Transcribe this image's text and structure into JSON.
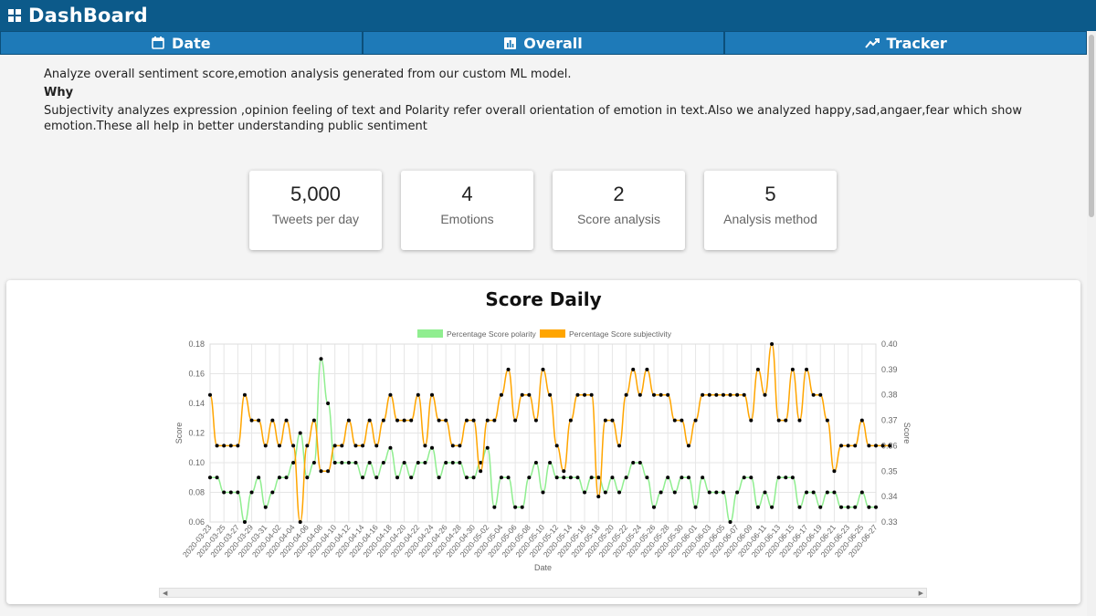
{
  "header": {
    "title": "DashBoard",
    "logo_icon": "dashboard-grid-icon"
  },
  "tabs": [
    {
      "label": "Date",
      "icon": "calendar-icon"
    },
    {
      "label": "Overall",
      "icon": "bar-chart-icon"
    },
    {
      "label": "Tracker",
      "icon": "trend-line-icon"
    }
  ],
  "intro": {
    "text": "Analyze overall sentiment score,emotion analysis generated from our custom ML model.",
    "why_heading": "Why",
    "why_text": "Subjectivity analyzes expression ,opinion feeling of text and Polarity refer overall orientation of emotion in text.Also we analyzed happy,sad,angaer,fear which show emotion.These all help in better understanding public sentiment"
  },
  "cards": [
    {
      "value": "5,000",
      "label": "Tweets per day"
    },
    {
      "value": "4",
      "label": "Emotions"
    },
    {
      "value": "2",
      "label": "Score analysis"
    },
    {
      "value": "5",
      "label": "Analysis method"
    }
  ],
  "colors": {
    "header": "#0c5a8a",
    "tab": "#1e7ab8",
    "polarity": "#90ee90",
    "subjectivity": "#ffa500"
  },
  "chart_data": {
    "type": "line",
    "title": "Score Daily",
    "xlabel": "Date",
    "ylabel_left": "Score",
    "ylabel_right": "Score",
    "x_start": "2020-03-23",
    "x_end": "2020-06-28",
    "tick_labels": [
      "2020-03-23",
      "2020-03-25",
      "2020-03-27",
      "2020-03-29",
      "2020-03-31",
      "2020-04-02",
      "2020-04-04",
      "2020-04-06",
      "2020-04-08",
      "2020-04-10",
      "2020-04-12",
      "2020-04-14",
      "2020-04-16",
      "2020-04-18",
      "2020-04-20",
      "2020-04-22",
      "2020-04-24",
      "2020-04-26",
      "2020-04-28",
      "2020-04-30",
      "2020-05-02",
      "2020-05-04",
      "2020-05-06",
      "2020-05-08",
      "2020-05-10",
      "2020-05-12",
      "2020-05-14",
      "2020-05-16",
      "2020-05-18",
      "2020-05-20",
      "2020-05-22",
      "2020-05-24",
      "2020-05-26",
      "2020-05-28",
      "2020-05-30",
      "2020-06-01",
      "2020-06-03",
      "2020-06-05",
      "2020-06-07",
      "2020-06-09",
      "2020-06-11",
      "2020-06-13",
      "2020-06-15",
      "2020-06-17",
      "2020-06-19",
      "2020-06-21",
      "2020-06-23",
      "2020-06-25",
      "2020-06-27"
    ],
    "y_left_range": [
      0.06,
      0.18
    ],
    "y_left_ticks": [
      "0.06",
      "0.08",
      "0.10",
      "0.12",
      "0.14",
      "0.16",
      "0.18"
    ],
    "y_right_range": [
      0.33,
      0.4
    ],
    "y_right_ticks": [
      "0.33",
      "0.34",
      "0.35",
      "0.36",
      "0.37",
      "0.38",
      "0.39",
      "0.40"
    ],
    "legend_position": "top",
    "series": [
      {
        "name": "Percentage Score polarity",
        "axis": "left",
        "color": "#90ee90",
        "values": [
          0.09,
          0.09,
          0.08,
          0.08,
          0.08,
          0.06,
          0.08,
          0.09,
          0.07,
          0.08,
          0.09,
          0.09,
          0.1,
          0.12,
          0.09,
          0.1,
          0.17,
          0.14,
          0.1,
          0.1,
          0.1,
          0.1,
          0.09,
          0.1,
          0.09,
          0.1,
          0.11,
          0.09,
          0.1,
          0.09,
          0.1,
          0.1,
          0.11,
          0.09,
          0.1,
          0.1,
          0.1,
          0.09,
          0.09,
          0.1,
          0.11,
          0.07,
          0.09,
          0.09,
          0.07,
          0.07,
          0.09,
          0.1,
          0.08,
          0.1,
          0.09,
          0.09,
          0.09,
          0.09,
          0.08,
          0.09,
          0.09,
          0.08,
          0.09,
          0.08,
          0.09,
          0.1,
          0.1,
          0.09,
          0.07,
          0.08,
          0.09,
          0.08,
          0.09,
          0.09,
          0.07,
          0.09,
          0.08,
          0.08,
          0.08,
          0.06,
          0.08,
          0.09,
          0.09,
          0.07,
          0.08,
          0.07,
          0.09,
          0.09,
          0.09,
          0.07,
          0.08,
          0.08,
          0.07,
          0.08,
          0.08,
          0.07,
          0.07,
          0.07,
          0.08,
          0.07,
          0.07
        ]
      },
      {
        "name": "Percentage Score subjectivity",
        "axis": "right",
        "color": "#ffa500",
        "values": [
          0.38,
          0.36,
          0.36,
          0.36,
          0.36,
          0.38,
          0.37,
          0.37,
          0.36,
          0.37,
          0.36,
          0.37,
          0.36,
          0.33,
          0.36,
          0.37,
          0.35,
          0.35,
          0.36,
          0.36,
          0.37,
          0.36,
          0.36,
          0.37,
          0.36,
          0.37,
          0.38,
          0.37,
          0.37,
          0.37,
          0.38,
          0.36,
          0.38,
          0.37,
          0.37,
          0.36,
          0.36,
          0.37,
          0.37,
          0.35,
          0.37,
          0.37,
          0.38,
          0.39,
          0.37,
          0.38,
          0.38,
          0.37,
          0.39,
          0.38,
          0.36,
          0.35,
          0.37,
          0.38,
          0.38,
          0.38,
          0.34,
          0.37,
          0.37,
          0.36,
          0.38,
          0.39,
          0.38,
          0.39,
          0.38,
          0.38,
          0.38,
          0.37,
          0.37,
          0.36,
          0.37,
          0.38,
          0.38,
          0.38,
          0.38,
          0.38,
          0.38,
          0.38,
          0.37,
          0.39,
          0.38,
          0.4,
          0.37,
          0.37,
          0.39,
          0.37,
          0.39,
          0.38,
          0.38,
          0.37,
          0.35,
          0.36,
          0.36,
          0.36,
          0.37,
          0.36,
          0.36,
          0.36,
          0.36
        ]
      }
    ]
  }
}
